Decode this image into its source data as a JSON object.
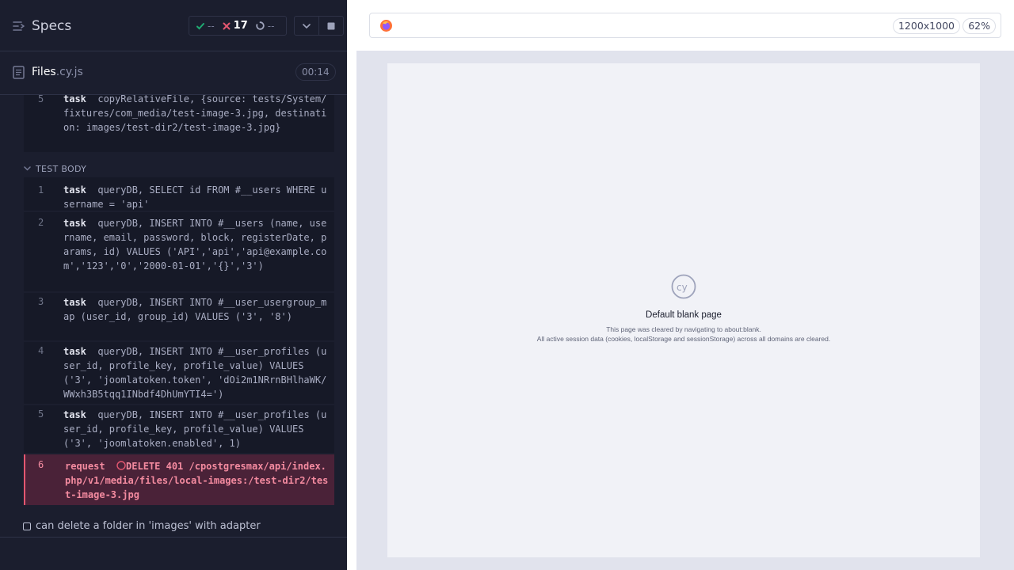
{
  "header": {
    "specs_label": "Specs",
    "stats": {
      "passed": "--",
      "failed": "17",
      "pending": "--"
    }
  },
  "file": {
    "name": "Files",
    "ext": ".cy.js",
    "duration": "00:14"
  },
  "hook_command": {
    "num": "5",
    "keyword": "task",
    "text": "copyRelativeFile, {source: tests/System/fixtures/com_media/test-image-3.jpg, destination: images/test-dir2/test-image-3.jpg}"
  },
  "test_body_label": "TEST BODY",
  "commands": [
    {
      "num": "1",
      "keyword": "task",
      "text": "queryDB, SELECT id FROM #__users WHERE username = 'api'"
    },
    {
      "num": "2",
      "keyword": "task",
      "text": "queryDB, INSERT INTO #__users (name, username, email, password, block, registerDate, params, id) VALUES ('API','api','api@example.com','123','0','2000-01-01','{}','3')"
    },
    {
      "num": "3",
      "keyword": "task",
      "text": "queryDB, INSERT INTO #__user_usergroup_map (user_id, group_id) VALUES ('3', '8')"
    },
    {
      "num": "4",
      "keyword": "task",
      "text": "queryDB, INSERT INTO #__user_profiles (user_id, profile_key, profile_value) VALUES ('3', 'joomlatoken.token', 'dOi2m1NRrnBHlhaWK/WWxh3B5tqq1INbdf4DhUmYTI4=')"
    },
    {
      "num": "5",
      "keyword": "task",
      "text": "queryDB, INSERT INTO #__user_profiles (user_id, profile_key, profile_value) VALUES ('3', 'joomlatoken.enabled', 1)"
    },
    {
      "num": "6",
      "keyword": "request",
      "text": "DELETE 401 /cpostgresmax/api/index.php/v1/media/files/local-images:/test-dir2/test-image-3.jpg",
      "error": true
    }
  ],
  "next_test": "can delete a folder in 'images' with adapter",
  "browser": {
    "icon": "firefox-icon",
    "viewport": "1200x1000",
    "zoom": "62%"
  },
  "blank_page": {
    "title": "Default blank page",
    "line1": "This page was cleared by navigating to about:blank.",
    "line2": "All active session data (cookies, localStorage and sessionStorage) across all domains are cleared."
  },
  "colors": {
    "failed": "#e45770",
    "passed": "#1fa971",
    "background": "#1b1e2e"
  }
}
